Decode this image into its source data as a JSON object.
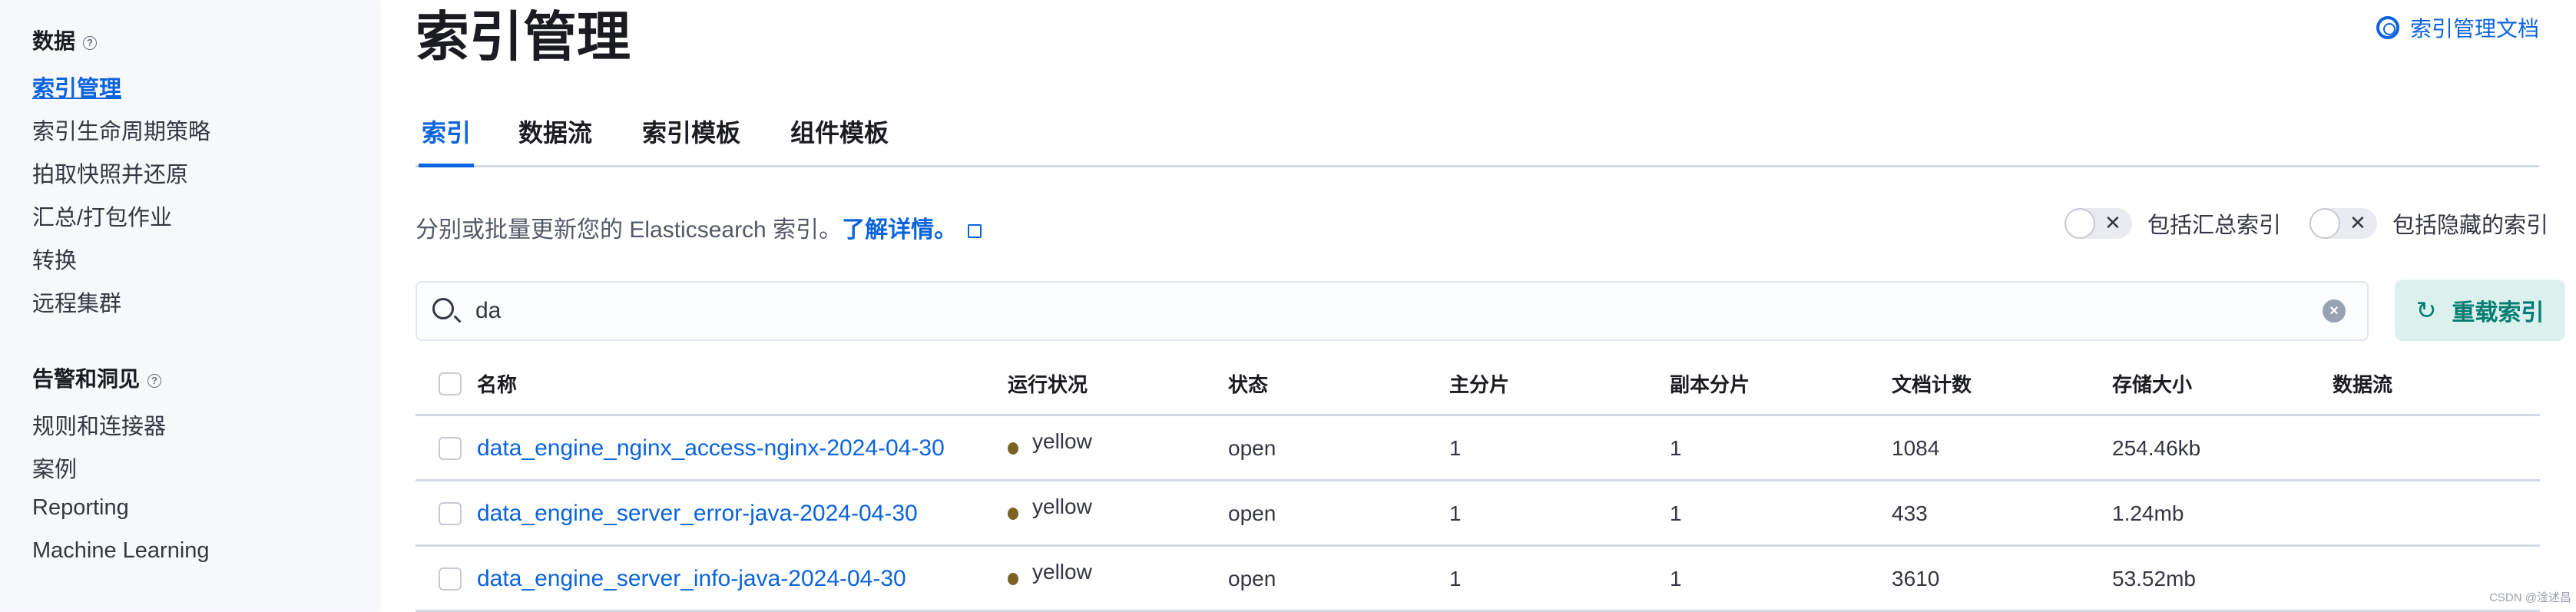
{
  "sidebar": {
    "groups": [
      {
        "label": "数据",
        "items": [
          "索引管理",
          "索引生命周期策略",
          "拍取快照并还原",
          "汇总/打包作业",
          "转换",
          "远程集群"
        ]
      },
      {
        "label": "告警和洞见",
        "items": [
          "规则和连接器",
          "案例",
          "Reporting",
          "Machine Learning"
        ]
      }
    ],
    "active": "索引管理"
  },
  "header": {
    "title": "索引管理",
    "doc_link": "索引管理文档"
  },
  "tabs": [
    {
      "label": "索引",
      "active": true
    },
    {
      "label": "数据流"
    },
    {
      "label": "索引模板"
    },
    {
      "label": "组件模板"
    }
  ],
  "description": {
    "text": "分别或批量更新您的 Elasticsearch 索引。",
    "link": "了解详情。"
  },
  "toggles": [
    {
      "label": "包括汇总索引",
      "on": false
    },
    {
      "label": "包括隐藏的索引",
      "on": false
    }
  ],
  "search": {
    "value": "da"
  },
  "reload_button": "重载索引",
  "table": {
    "columns": [
      "名称",
      "运行状况",
      "状态",
      "主分片",
      "副本分片",
      "文档计数",
      "存储大小",
      "数据流"
    ],
    "rows": [
      {
        "name": "data_engine_nginx_access-nginx-2024-04-30",
        "health": "yellow",
        "status": "open",
        "primary": "1",
        "replica": "1",
        "docs": "1084",
        "size": "254.46kb",
        "stream": ""
      },
      {
        "name": "data_engine_server_error-java-2024-04-30",
        "health": "yellow",
        "status": "open",
        "primary": "1",
        "replica": "1",
        "docs": "433",
        "size": "1.24mb",
        "stream": ""
      },
      {
        "name": "data_engine_server_info-java-2024-04-30",
        "health": "yellow",
        "status": "open",
        "primary": "1",
        "replica": "1",
        "docs": "3610",
        "size": "53.52mb",
        "stream": ""
      }
    ]
  },
  "colors": {
    "accent": "#0b64dd",
    "health_yellow": "#7b6323",
    "reload_bg": "#dcf1ee"
  },
  "watermark": "CSDN @淦述昌"
}
